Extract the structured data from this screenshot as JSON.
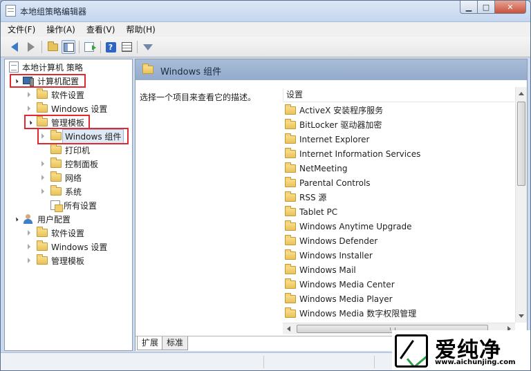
{
  "window": {
    "title": "本地组策略编辑器",
    "caption": {
      "minimize": "▁",
      "maximize": "□",
      "close": "✕"
    }
  },
  "menubar": {
    "items": [
      "文件(F)",
      "操作(A)",
      "查看(V)",
      "帮助(H)"
    ]
  },
  "toolbar": {
    "icons": [
      "back-arrow-icon",
      "forward-arrow-icon",
      "up-folder-icon",
      "show-hide-pane-icon",
      "export-list-icon",
      "help-icon",
      "grid-view-icon",
      "filter-icon"
    ],
    "help_glyph": "?"
  },
  "tree": {
    "root": "本地计算机 策略",
    "computer_config": "计算机配置",
    "cc_software": "软件设置",
    "cc_windows": "Windows 设置",
    "cc_admin": "管理模板",
    "admin_windows_components": "Windows 组件",
    "admin_printers": "打印机",
    "admin_control_panel": "控制面板",
    "admin_network": "网络",
    "admin_system": "系统",
    "admin_all_settings": "所有设置",
    "user_config": "用户配置",
    "uc_software": "软件设置",
    "uc_windows": "Windows 设置",
    "uc_admin": "管理模板"
  },
  "details": {
    "header_title": "Windows 组件",
    "description": "选择一个项目来查看它的描述。",
    "column_header": "设置",
    "items": [
      "ActiveX 安装程序服务",
      "BitLocker 驱动器加密",
      "Internet Explorer",
      "Internet Information Services",
      "NetMeeting",
      "Parental Controls",
      "RSS 源",
      "Tablet PC",
      "Windows Anytime Upgrade",
      "Windows Defender",
      "Windows Installer",
      "Windows Mail",
      "Windows Media Center",
      "Windows Media Player",
      "Windows Media 数字权限管理"
    ]
  },
  "tabs": [
    "扩展",
    "标准"
  ],
  "watermark": {
    "brand": "爱纯净",
    "url": "www.aichunjing.com"
  },
  "colors": {
    "highlight_box": "#e0282e",
    "header_bar": "#a9bdd8",
    "folder": "#e9c25a"
  }
}
